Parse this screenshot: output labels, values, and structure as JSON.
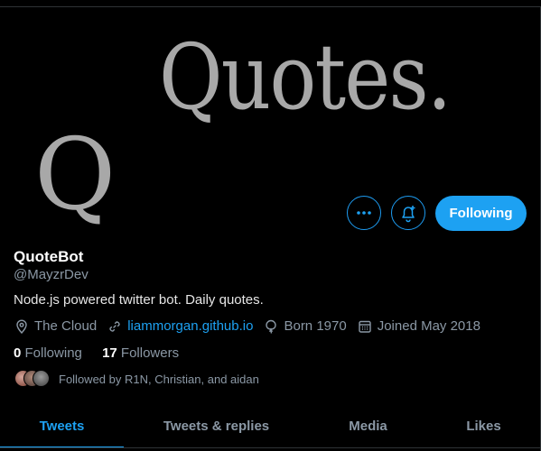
{
  "banner": {
    "text": "Quotes."
  },
  "avatar": {
    "letter": "Q"
  },
  "actions": {
    "more_icon": "ellipsis-icon",
    "notify_icon": "bell-plus-icon",
    "follow_label": "Following",
    "accent_color": "#1da1f2"
  },
  "profile": {
    "display_name": "QuoteBot",
    "handle": "@MayzrDev",
    "bio": "Node.js powered twitter bot. Daily quotes.",
    "location": "The Cloud",
    "website": "liammorgan.github.io",
    "born": "Born 1970",
    "joined": "Joined May 2018"
  },
  "stats": {
    "following_count": "0",
    "following_label": "Following",
    "followers_count": "17",
    "followers_label": "Followers"
  },
  "followed_by": {
    "text": "Followed by R1N, Christian, and aidan"
  },
  "tabs": [
    {
      "label": "Tweets",
      "active": true
    },
    {
      "label": "Tweets & replies",
      "active": false
    },
    {
      "label": "Media",
      "active": false
    },
    {
      "label": "Likes",
      "active": false
    }
  ]
}
